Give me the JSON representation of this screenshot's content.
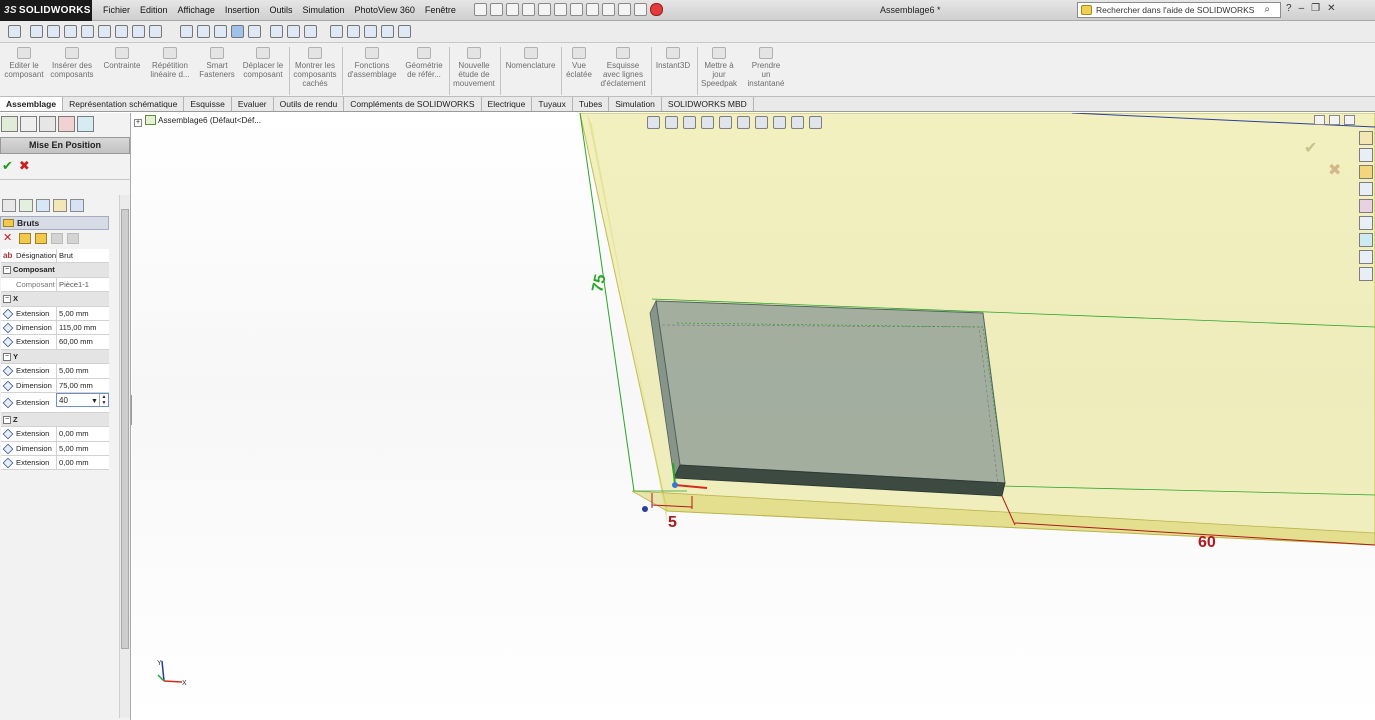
{
  "app": {
    "brand": "SOLIDWORKS",
    "brand_prefix": "3S",
    "document_title": "Assemblage6 *"
  },
  "menu": [
    "Fichier",
    "Edition",
    "Affichage",
    "Insertion",
    "Outils",
    "Simulation",
    "PhotoView 360",
    "Fenêtre"
  ],
  "search": {
    "placeholder": "Rechercher dans l'aide de SOLIDWORKS"
  },
  "commands": [
    {
      "label": "Editer le\ncomposant"
    },
    {
      "label": "Insérer des\ncomposants"
    },
    {
      "label": "Contrainte"
    },
    {
      "label": "Répétition\nlinéaire d..."
    },
    {
      "label": "Smart\nFasteners"
    },
    {
      "label": "Déplacer le\ncomposant"
    },
    {
      "label": "Montrer les\ncomposants\ncachés"
    },
    {
      "label": "Fonctions\nd'assemblage"
    },
    {
      "label": "Géométrie\nde référ..."
    },
    {
      "label": "Nouvelle\nétude de\nmouvement"
    },
    {
      "label": "Nomenclature"
    },
    {
      "label": "Vue\néclatée"
    },
    {
      "label": "Esquisse\navec lignes\nd'éclatement"
    },
    {
      "label": "Instant3D"
    },
    {
      "label": "Mettre à\njour\nSpeedpak"
    },
    {
      "label": "Prendre\nun\ninstantané"
    }
  ],
  "tabs": [
    "Assemblage",
    "Représentation schématique",
    "Esquisse",
    "Evaluer",
    "Outils de rendu",
    "Compléments de SOLIDWORKS",
    "Electrique",
    "Tuyaux",
    "Tubes",
    "Simulation",
    "SOLIDWORKS MBD"
  ],
  "active_tab": "Assemblage",
  "panel": {
    "title": "Mise En Position",
    "ok": "✔",
    "cancel": "✖",
    "group": "Bruts",
    "designation_label": "Désignation",
    "designation_value": "Brut",
    "section_component": "Composant",
    "component_label": "Composant",
    "component_value": "Pièce1-1",
    "section_x": "X",
    "section_y": "Y",
    "section_z": "Z",
    "x_rows": [
      {
        "label": "Extension",
        "value": "5,00 mm"
      },
      {
        "label": "Dimension",
        "value": "115,00 mm"
      },
      {
        "label": "Extension",
        "value": "60,00 mm"
      }
    ],
    "y_rows": [
      {
        "label": "Extension",
        "value": "5,00 mm"
      },
      {
        "label": "Dimension",
        "value": "75,00 mm"
      }
    ],
    "y_edit": {
      "label": "Extension",
      "value": "40"
    },
    "z_rows": [
      {
        "label": "Extension",
        "value": "0,00 mm"
      },
      {
        "label": "Dimension",
        "value": "5,00 mm"
      },
      {
        "label": "Extension",
        "value": "0,00 mm"
      }
    ]
  },
  "tree": {
    "item": "Assemblage6  (Défaut<Déf..."
  },
  "dimensions": {
    "d75": "75",
    "d5": "5",
    "d60": "60"
  },
  "triad": {
    "x": "X",
    "y": "Y"
  },
  "colors": {
    "stock": "#e8e48a",
    "part_body": "#8d9c97",
    "dim_green": "#2aa52a",
    "dim_red": "#b0171b"
  }
}
